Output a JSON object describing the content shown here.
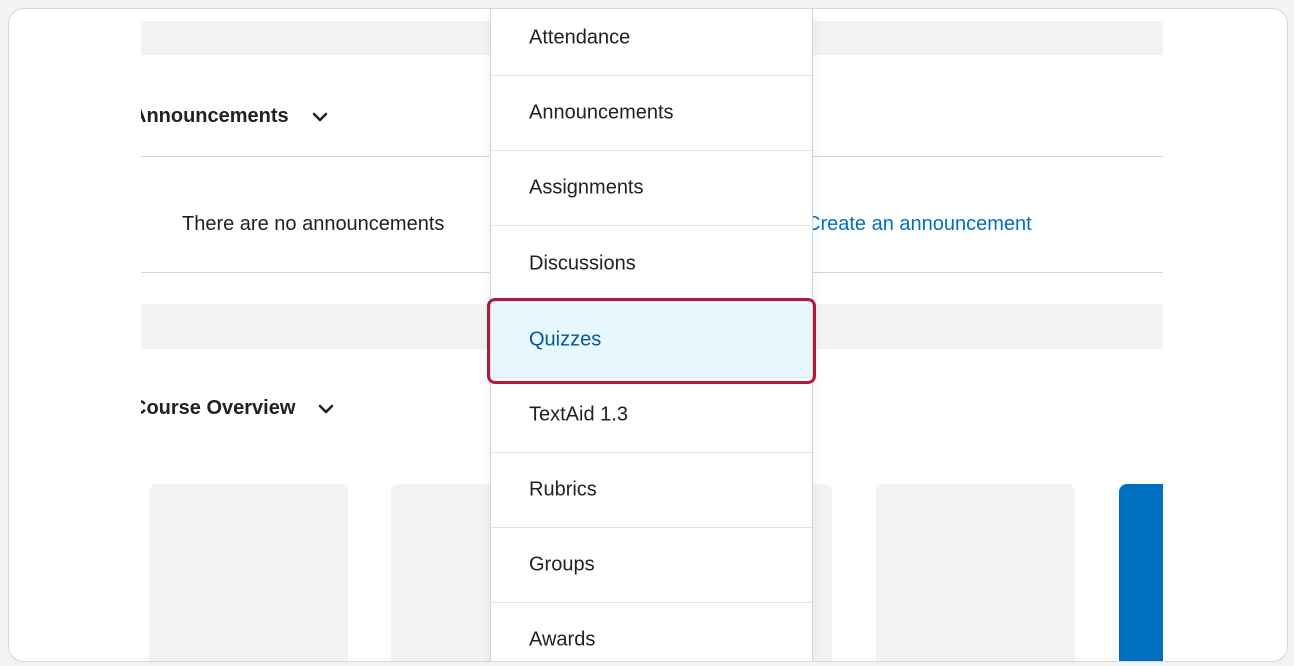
{
  "widgets": {
    "announcements": {
      "title": "Announcements",
      "empty_message": "There are no announcements",
      "create_link": "Create an announcement"
    },
    "course_overview": {
      "title": "Course Overview"
    }
  },
  "dropdown_menu": {
    "items": [
      {
        "label": "Attendance"
      },
      {
        "label": "Announcements"
      },
      {
        "label": "Assignments"
      },
      {
        "label": "Discussions"
      },
      {
        "label": "Quizzes",
        "state": "hovered"
      },
      {
        "label": "TextAid 1.3"
      },
      {
        "label": "Rubrics"
      },
      {
        "label": "Groups"
      },
      {
        "label": "Awards"
      }
    ]
  },
  "colors": {
    "accent_highlight": "#b4183f",
    "link_blue": "#006fbf",
    "hover_bg": "#e8f6fd"
  }
}
